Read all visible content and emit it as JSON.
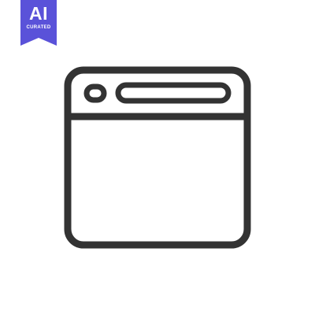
{
  "badge": {
    "title": "AI",
    "subtitle": "CURATED",
    "color": "#5a52d9"
  },
  "icon": {
    "name": "browser-window-icon",
    "stroke_color": "#333333"
  }
}
